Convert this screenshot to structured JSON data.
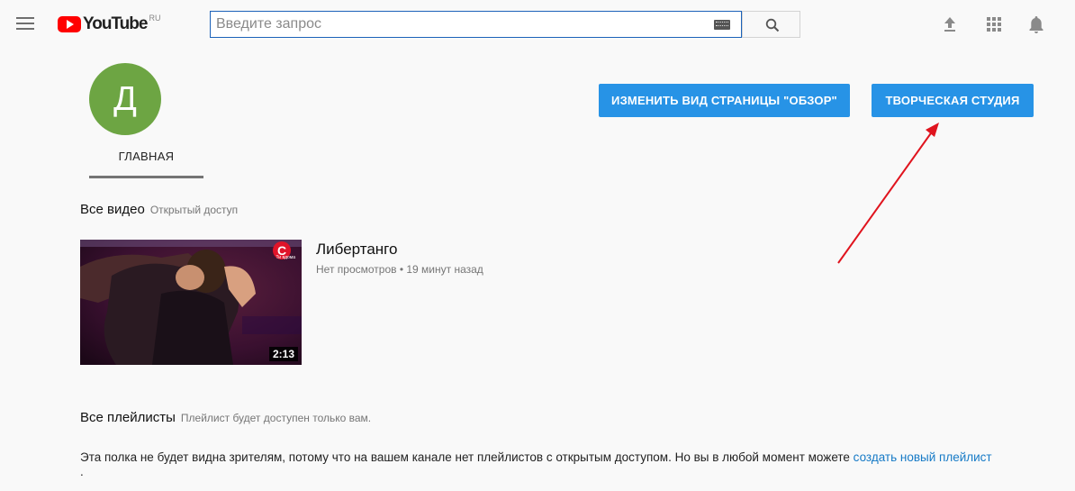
{
  "header": {
    "logo_text": "YouTube",
    "logo_region": "RU",
    "search_placeholder": "Введите запрос",
    "icons": [
      "hamburger-icon",
      "keyboard-icon",
      "search-icon",
      "upload-icon",
      "apps-icon",
      "bell-icon"
    ]
  },
  "channel": {
    "avatar_letter": "Д",
    "avatar_color": "#6da543",
    "tab_home": "ГЛАВНАЯ",
    "customize_button": "ИЗМЕНИТЬ ВИД СТРАНИЦЫ \"ОБЗОР\"",
    "studio_button": "ТВОРЧЕСКАЯ СТУДИЯ",
    "button_color": "#2793e6"
  },
  "videos_section": {
    "title": "Все видео",
    "subtitle": "Открытый доступ",
    "video": {
      "title": "Либертанго",
      "meta": "Нет просмотров • 19 минут назад",
      "duration": "2:13",
      "badge_letter": "C",
      "badge_label": "Ти вдома"
    }
  },
  "playlists_section": {
    "title": "Все плейлисты",
    "subtitle": "Плейлист будет доступен только вам.",
    "note_text": "Эта полка не будет видна зрителям, потому что на вашем канале нет плейлистов с открытым доступом. Но вы в любой момент можете ",
    "note_link": "создать новый плейлист",
    "note_end": "."
  },
  "annotation": {
    "arrow_color": "#e0141e"
  }
}
